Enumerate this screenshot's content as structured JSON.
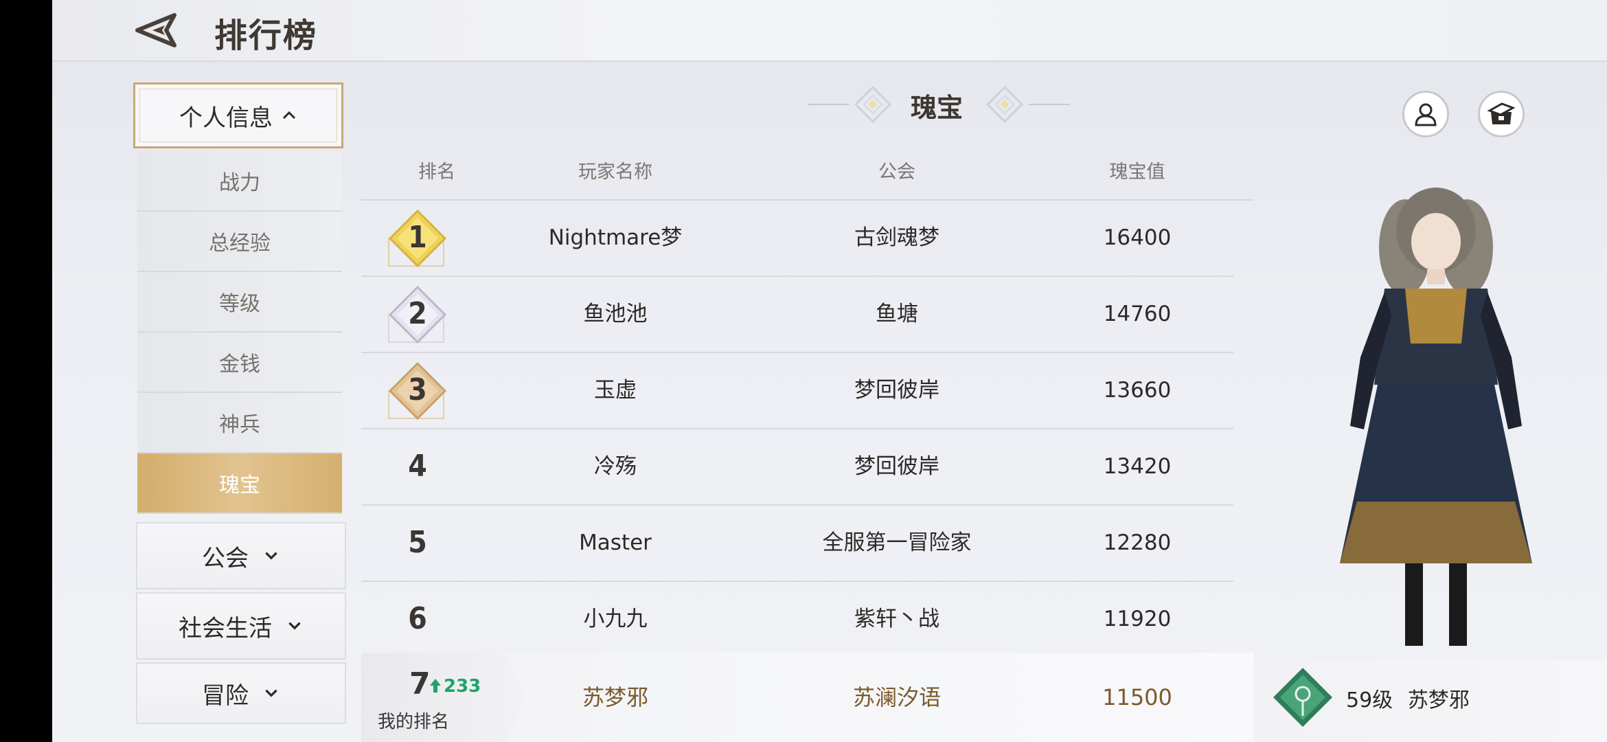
{
  "header": {
    "title": "排行榜"
  },
  "menu": {
    "header_label": "个人信息",
    "sub_items": [
      {
        "label": "战力"
      },
      {
        "label": "总经验"
      },
      {
        "label": "等级"
      },
      {
        "label": "金钱"
      },
      {
        "label": "神兵"
      },
      {
        "label": "瑰宝",
        "active": true
      }
    ],
    "groups": [
      {
        "label": "公会"
      },
      {
        "label": "社会生活"
      },
      {
        "label": "冒险"
      }
    ]
  },
  "category": {
    "title": "瑰宝"
  },
  "table": {
    "headers": {
      "rank": "排名",
      "name": "玩家名称",
      "guild": "公会",
      "value": "瑰宝值"
    },
    "rows": [
      {
        "rank": "1",
        "name": "Nightmare梦",
        "guild": "古剑魂梦",
        "value": "16400",
        "medal": "gold"
      },
      {
        "rank": "2",
        "name": "鱼池池",
        "guild": "鱼塘",
        "value": "14760",
        "medal": "silver"
      },
      {
        "rank": "3",
        "name": "玉虚",
        "guild": "梦回彼岸",
        "value": "13660",
        "medal": "bronze"
      },
      {
        "rank": "4",
        "name": "冷殇",
        "guild": "梦回彼岸",
        "value": "13420"
      },
      {
        "rank": "5",
        "name": "Master",
        "guild": "全服第一冒险家",
        "value": "12280"
      },
      {
        "rank": "6",
        "name": "小九九",
        "guild": "紫轩丶战",
        "value": "11920"
      }
    ]
  },
  "my_rank": {
    "rank": "7",
    "change": "233",
    "label": "我的排名",
    "name": "苏梦邪",
    "guild": "苏澜汐语",
    "value": "11500"
  },
  "player": {
    "level": "59级",
    "name": "苏梦邪"
  },
  "icons": [
    "back-icon",
    "profile-icon",
    "chest-icon",
    "caret-up-icon",
    "chevron-down-icon",
    "arrow-up-icon",
    "guild-emblem-icon"
  ],
  "colors": {
    "accent_gold": "#d3ae6c",
    "highlight_text": "#7a5a2c",
    "rank_up_green": "#1ea36b"
  }
}
